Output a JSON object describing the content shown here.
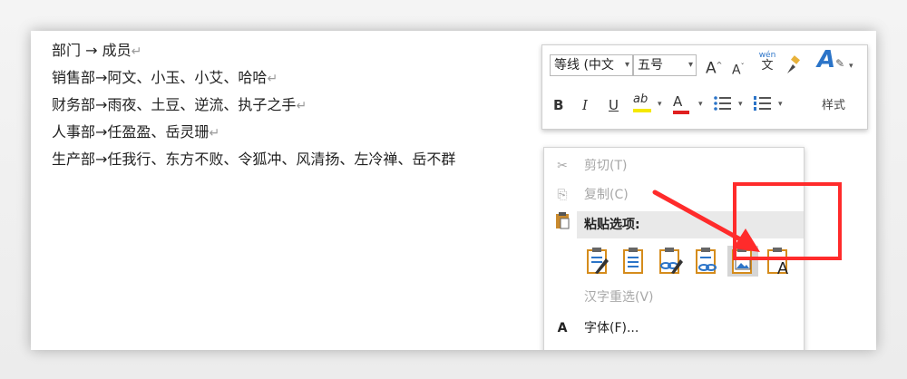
{
  "document": {
    "lines": [
      {
        "dept": "部门",
        "sep": " → ",
        "members": "成员"
      },
      {
        "dept": "销售部",
        "sep": "→",
        "members": "阿文、小玉、小艾、哈哈"
      },
      {
        "dept": "财务部",
        "sep": "→",
        "members": "雨夜、土豆、逆流、执子之手"
      },
      {
        "dept": "人事部",
        "sep": "→",
        "members": "任盈盈、岳灵珊"
      },
      {
        "dept": "生产部",
        "sep": "→",
        "members": "任我行、东方不败、令狐冲、风清扬、左冷禅、岳不群"
      }
    ],
    "para_mark": "↵"
  },
  "mini_toolbar": {
    "font_name": "等线 (中文",
    "font_size": "五号",
    "grow_font": "A",
    "shrink_font": "A",
    "phonetic_top": "wén",
    "phonetic_bottom": "文",
    "bold": "B",
    "italic": "I",
    "underline": "U",
    "highlight": "ab",
    "font_color": "A",
    "styles_label": "样式",
    "accent_blue": "#2b74c8",
    "highlight_color": "#f5e800",
    "font_color_red": "#e02020"
  },
  "context_menu": {
    "cut": "剪切(T)",
    "copy": "复制(C)",
    "paste_options": "粘贴选项:",
    "reconvert": "汉字重选(V)",
    "font": "字体(F)...",
    "font_icon": "A"
  },
  "annotation": {
    "box_color": "#ff2b2b",
    "arrow_color": "#ff2b2b"
  }
}
